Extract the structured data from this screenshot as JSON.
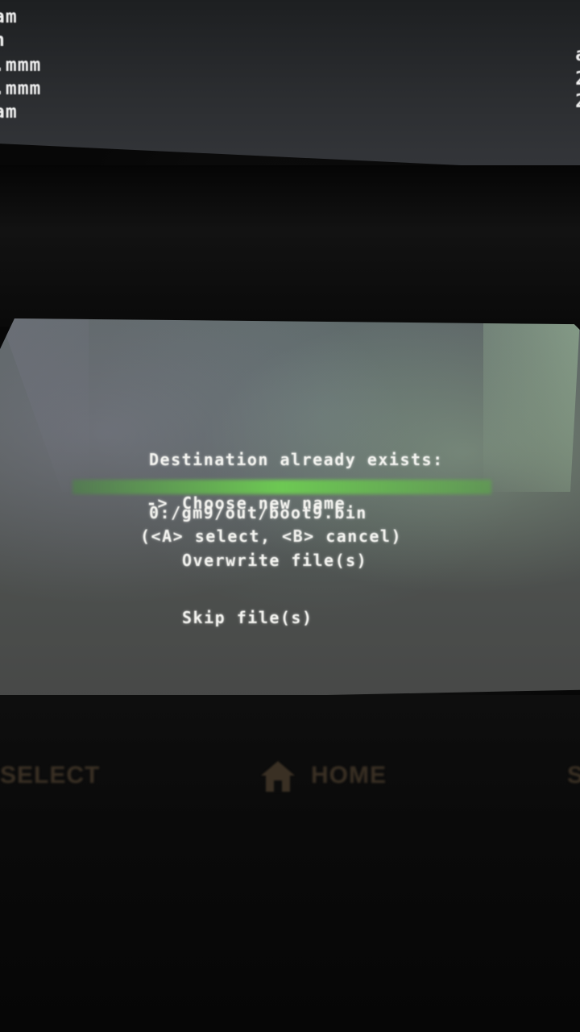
{
  "top_screen": {
    "lines": [
      "am",
      "n",
      ".mmm",
      ".mmm",
      "am"
    ],
    "right_lines": [
      "a",
      "2",
      "2"
    ]
  },
  "dialog": {
    "title": "Destination already exists:",
    "path": "0:/gm9/out/boot9.bin",
    "cursor": "->",
    "options": [
      {
        "label": "Choose new name",
        "selected": true
      },
      {
        "label": "Overwrite file(s)",
        "selected": false
      },
      {
        "label": "Skip file(s)",
        "selected": false
      }
    ],
    "hint": "(<A> select, <B> cancel)"
  },
  "hardware": {
    "select_label": "SELECT",
    "home_label": "HOME",
    "start_label": "S"
  },
  "colors": {
    "text": "#f4f4f0",
    "highlight_green": "#6ed250",
    "screen_bg": "#555a58"
  }
}
